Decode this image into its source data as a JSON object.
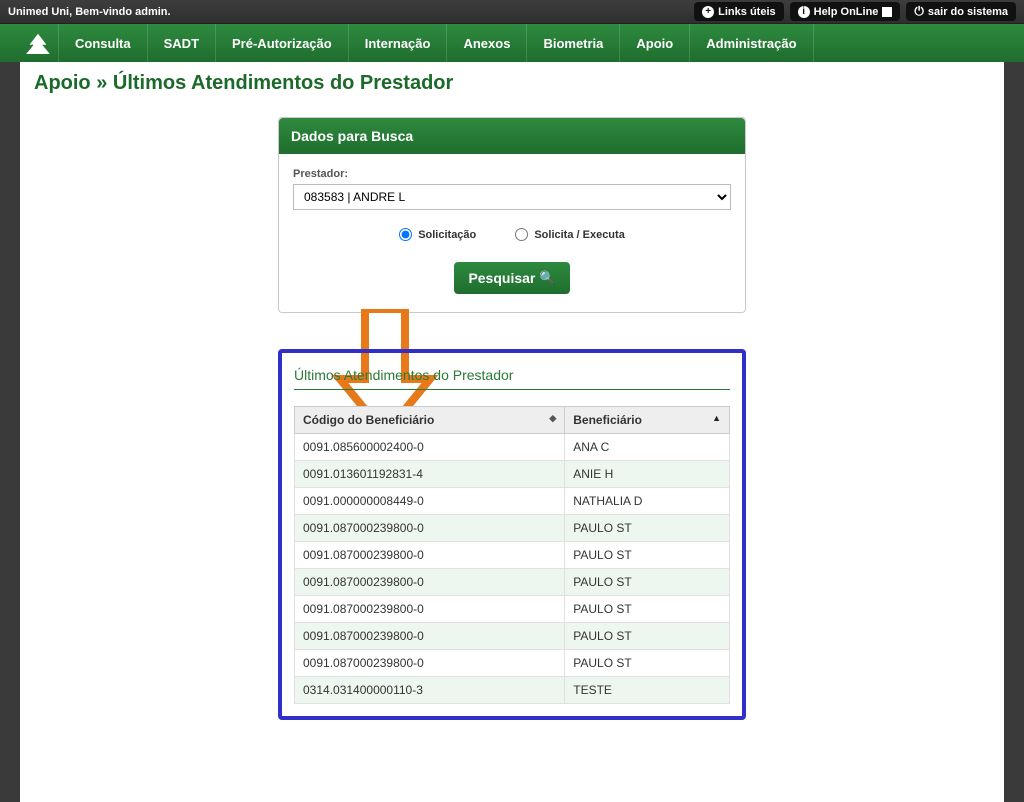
{
  "topbar": {
    "welcome": "Unimed Uni, Bem-vindo admin.",
    "links_uteis": "Links úteis",
    "help_online": "Help OnLine",
    "sair": "sair do sistema"
  },
  "nav": {
    "items": [
      "Consulta",
      "SADT",
      "Pré-Autorização",
      "Internação",
      "Anexos",
      "Biometria",
      "Apoio",
      "Administração"
    ]
  },
  "breadcrumb": "Apoio » Últimos Atendimentos do Prestador",
  "search": {
    "panel_title": "Dados para Busca",
    "prestador_label": "Prestador:",
    "prestador_value": "083583 | ANDRE L",
    "radio_solicitacao": "Solicitação",
    "radio_solicita_executa": "Solicita / Executa",
    "pesquisar": "Pesquisar"
  },
  "results": {
    "title": "Últimos Atendimentos do Prestador",
    "col_codigo": "Código do Beneficiário",
    "col_beneficiario": "Beneficiário",
    "rows": [
      {
        "codigo": "0091.085600002400-0",
        "nome": "ANA C"
      },
      {
        "codigo": "0091.013601192831-4",
        "nome": "ANIE H"
      },
      {
        "codigo": "0091.000000008449-0",
        "nome": "NATHALIA D"
      },
      {
        "codigo": "0091.087000239800-0",
        "nome": "PAULO ST"
      },
      {
        "codigo": "0091.087000239800-0",
        "nome": "PAULO ST"
      },
      {
        "codigo": "0091.087000239800-0",
        "nome": "PAULO ST"
      },
      {
        "codigo": "0091.087000239800-0",
        "nome": "PAULO ST"
      },
      {
        "codigo": "0091.087000239800-0",
        "nome": "PAULO ST"
      },
      {
        "codigo": "0091.087000239800-0",
        "nome": "PAULO ST"
      },
      {
        "codigo": "0314.031400000110-3",
        "nome": "TESTE"
      }
    ]
  }
}
